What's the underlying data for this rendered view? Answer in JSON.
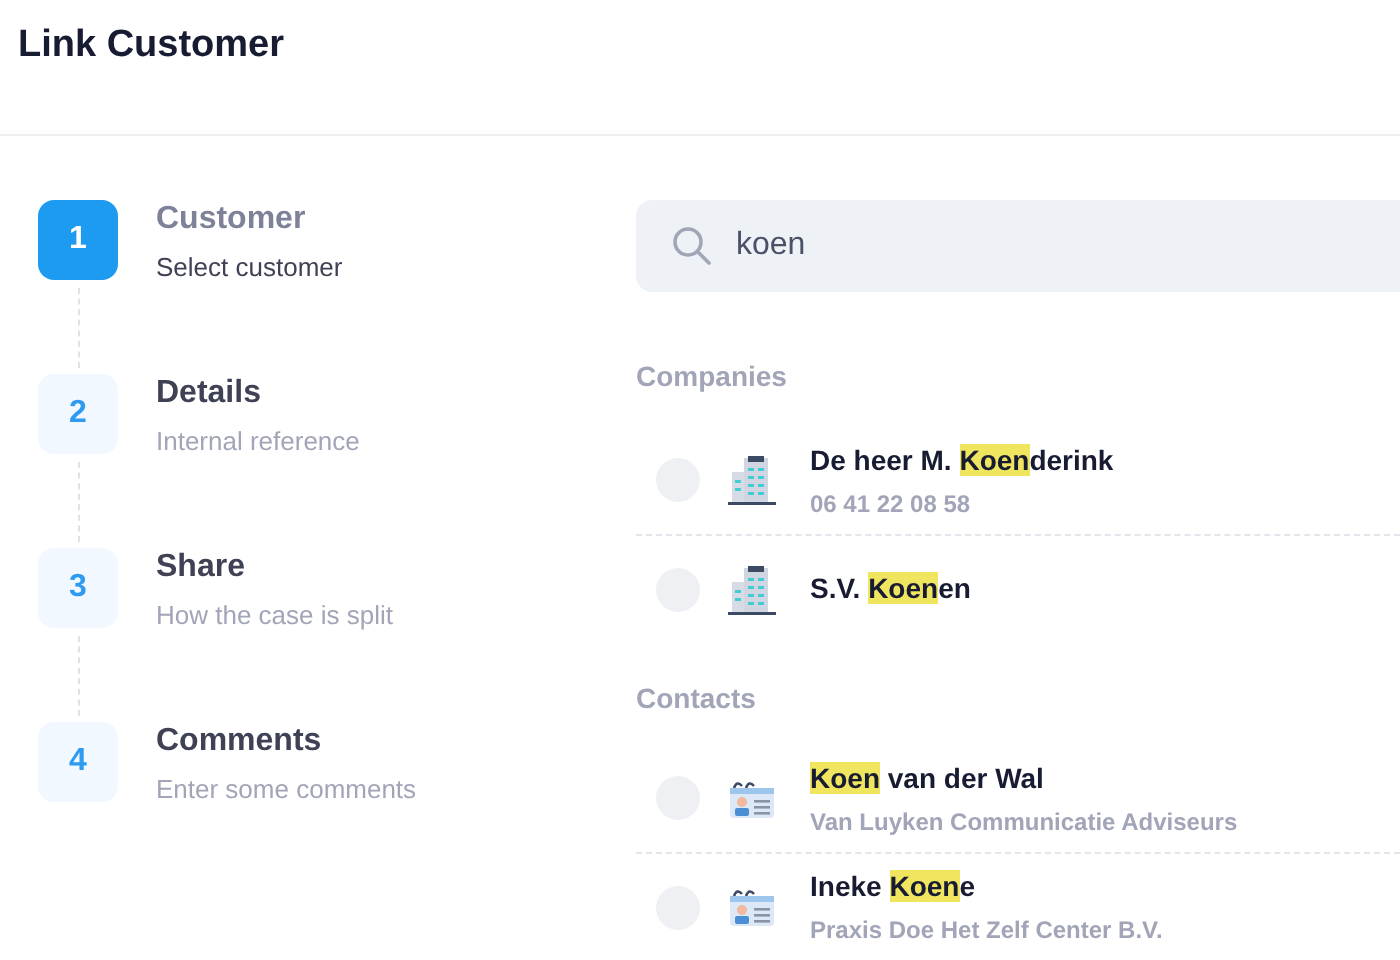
{
  "header": {
    "title": "Link Customer"
  },
  "steps": [
    {
      "number": "1",
      "title": "Customer",
      "subtitle": "Select customer",
      "selected": true
    },
    {
      "number": "2",
      "title": "Details",
      "subtitle": "Internal reference",
      "selected": false
    },
    {
      "number": "3",
      "title": "Share",
      "subtitle": "How the case is split",
      "selected": false
    },
    {
      "number": "4",
      "title": "Comments",
      "subtitle": "Enter some comments",
      "selected": false
    }
  ],
  "search": {
    "value": "koen"
  },
  "groups": [
    {
      "label": "Companies",
      "items": [
        {
          "kind": "company",
          "selected": false,
          "name": [
            {
              "text": "De heer M. ",
              "highlighted": false
            },
            {
              "text": "Koen",
              "highlighted": true
            },
            {
              "text": "derink",
              "highlighted": false
            }
          ],
          "detail": "06 41 22 08 58"
        },
        {
          "kind": "company",
          "selected": false,
          "name": [
            {
              "text": "S.V. ",
              "highlighted": false
            },
            {
              "text": "Koen",
              "highlighted": true
            },
            {
              "text": "en",
              "highlighted": false
            }
          ]
        }
      ]
    },
    {
      "label": "Contacts",
      "items": [
        {
          "kind": "contact",
          "selected": false,
          "name": [
            {
              "text": "Koen",
              "highlighted": true
            },
            {
              "text": " van der Wal",
              "highlighted": false
            }
          ],
          "detail": "Van Luyken Communicatie Adviseurs"
        },
        {
          "kind": "contact",
          "selected": false,
          "name": [
            {
              "text": "Ineke ",
              "highlighted": false
            },
            {
              "text": "Koen",
              "highlighted": true
            },
            {
              "text": "e",
              "highlighted": false
            }
          ],
          "detail": "Praxis Doe Het Zelf Center B.V."
        }
      ]
    }
  ]
}
